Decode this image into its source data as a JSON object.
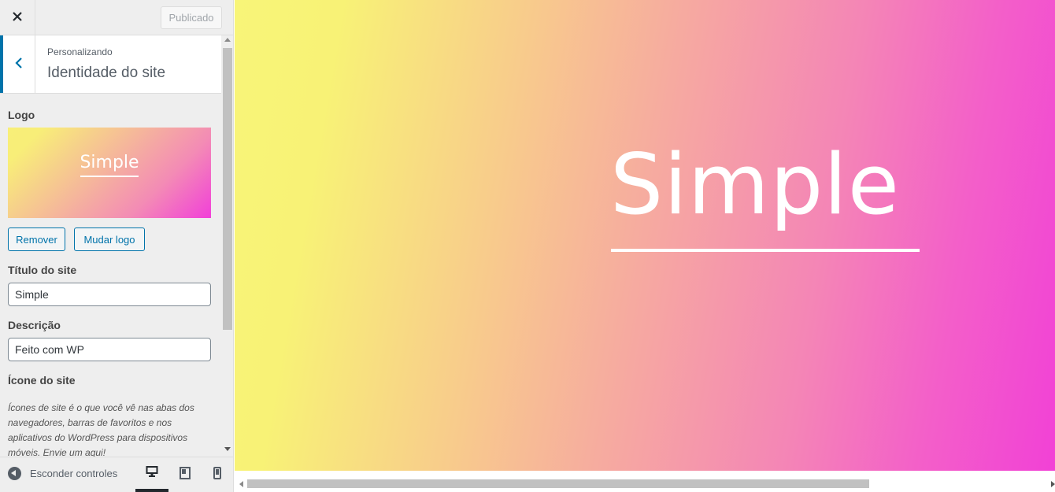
{
  "topbar": {
    "publish_label": "Publicado"
  },
  "section": {
    "crumb": "Personalizando",
    "title": "Identidade do site"
  },
  "logo": {
    "label": "Logo",
    "preview_text": "Simple",
    "remove_label": "Remover",
    "change_label": "Mudar logo"
  },
  "site_title": {
    "label": "Título do site",
    "value": "Simple"
  },
  "tagline": {
    "label": "Descrição",
    "value": "Feito com WP"
  },
  "site_icon": {
    "label": "Ícone do site",
    "description": "Ícones de site é o que você vê nas abas dos navegadores, barras de favoritos e nos aplicativos do WordPress para dispositivos móveis. Envie um aqui!"
  },
  "footer": {
    "hide_controls_label": "Esconder controles",
    "devices": [
      "desktop-icon",
      "tablet-icon",
      "mobile-icon"
    ],
    "active_device": "desktop"
  },
  "preview": {
    "logo_text": "Simple"
  },
  "colors": {
    "accent": "#0073aa",
    "gradient_start": "#f8f578",
    "gradient_end": "#f241d6"
  }
}
